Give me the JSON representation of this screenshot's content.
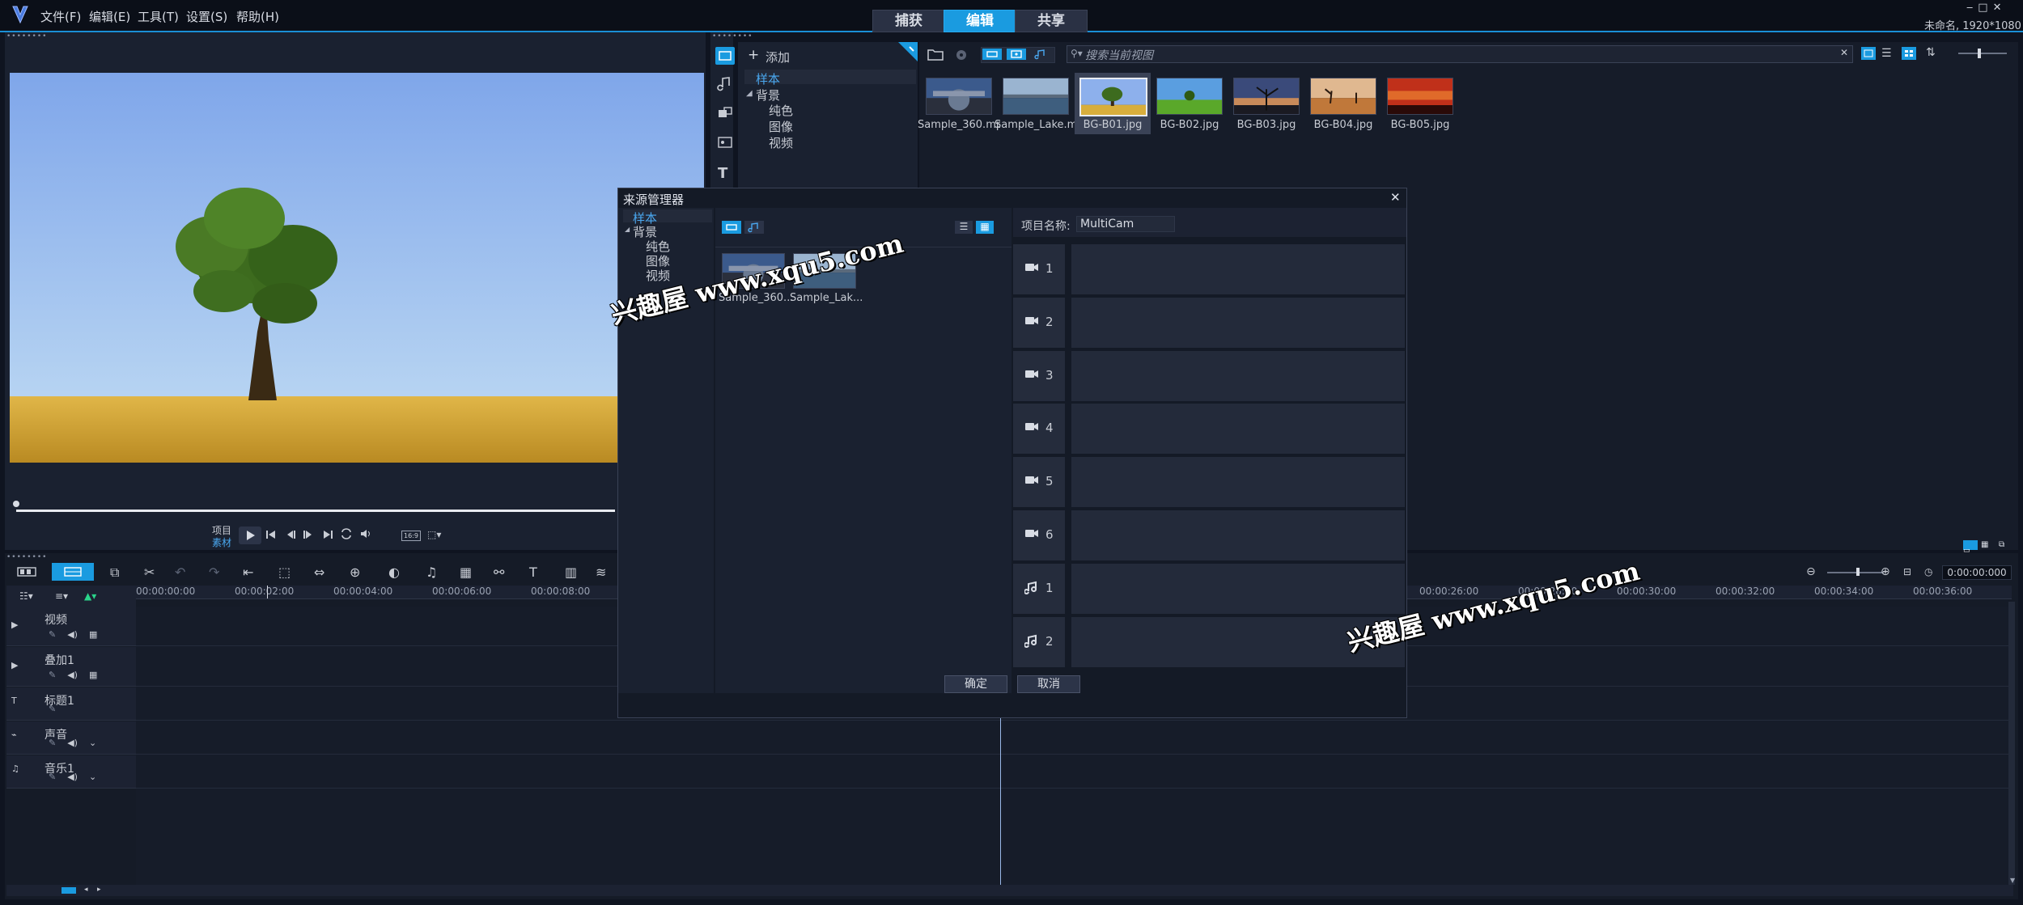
{
  "menu": [
    "文件(F)",
    "编辑(E)",
    "工具(T)",
    "设置(S)",
    "帮助(H)"
  ],
  "modes": [
    {
      "label": "捕获",
      "active": false
    },
    {
      "label": "编辑",
      "active": true
    },
    {
      "label": "共享",
      "active": false
    }
  ],
  "project_info": "未命名, 1920*1080",
  "library": {
    "add_label": "添加",
    "search_placeholder": "搜索当前视图",
    "tree": {
      "sample": "样本",
      "background": "背景",
      "solid": "纯色",
      "image": "图像",
      "video": "视频"
    },
    "thumbs": [
      {
        "label": "Sample_360.mp4",
        "scene": "city360"
      },
      {
        "label": "Sample_Lake.m...",
        "scene": "lake"
      },
      {
        "label": "BG-B01.jpg",
        "scene": "tree",
        "selected": true
      },
      {
        "label": "BG-B02.jpg",
        "scene": "green"
      },
      {
        "label": "BG-B03.jpg",
        "scene": "dusk"
      },
      {
        "label": "BG-B04.jpg",
        "scene": "desert"
      },
      {
        "label": "BG-B05.jpg",
        "scene": "red"
      }
    ]
  },
  "player": {
    "project_label": "项目",
    "clip_label": "素材",
    "aspect": "16:9"
  },
  "dialog": {
    "title": "来源管理器",
    "tree": {
      "sample": "样本",
      "background": "背景",
      "solid": "纯色",
      "image": "图像",
      "video": "视频"
    },
    "clips": [
      {
        "label": "Sample_360...",
        "scene": "city360"
      },
      {
        "label": "Sample_Lak...",
        "scene": "lake"
      }
    ],
    "project_name_label": "项目名称:",
    "project_name_value": "MultiCam",
    "rows": [
      {
        "type": "camera",
        "num": "1"
      },
      {
        "type": "camera",
        "num": "2"
      },
      {
        "type": "camera",
        "num": "3"
      },
      {
        "type": "camera",
        "num": "4"
      },
      {
        "type": "camera",
        "num": "5"
      },
      {
        "type": "camera",
        "num": "6"
      },
      {
        "type": "audio",
        "num": "1"
      },
      {
        "type": "audio",
        "num": "2"
      }
    ],
    "ok": "确定",
    "cancel": "取消"
  },
  "timeline": {
    "timecode": "0:00:00:000",
    "ruler": [
      "00:00:00:00",
      "00:00:02:00",
      "00:00:04:00",
      "00:00:06:00",
      "00:00:08:00",
      "00:00:26:00",
      "00:00:28:00",
      "00:00:30:00",
      "00:00:32:00",
      "00:00:34:00",
      "00:00:36:00"
    ],
    "tracks": [
      {
        "name": "视频",
        "icon": "video-track-icon"
      },
      {
        "name": "叠加1",
        "icon": "overlay-track-icon"
      },
      {
        "name": "标题1",
        "icon": "title-track-icon"
      },
      {
        "name": "声音",
        "icon": "voice-track-icon"
      },
      {
        "name": "音乐1",
        "icon": "music-track-icon"
      }
    ]
  },
  "watermark": "兴趣屋 www.xqu5.com",
  "colors": {
    "accent": "#1a9be0",
    "bg": "#0f1420",
    "panel": "#1a2130"
  }
}
